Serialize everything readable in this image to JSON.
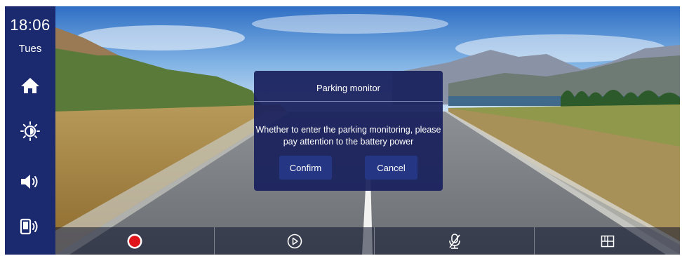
{
  "status": {
    "time": "18:06",
    "day": "Tues"
  },
  "sidebar": {
    "icons": [
      "home-icon",
      "brightness-icon",
      "volume-icon",
      "device-sound-icon"
    ]
  },
  "dialog": {
    "title": "Parking monitor",
    "message_line1": "Whether to enter the parking monitoring, please",
    "message_line2": "pay attention to the battery power",
    "confirm_label": "Confirm",
    "cancel_label": "Cancel"
  },
  "bottombar": {
    "icons": [
      "record-icon",
      "play-icon",
      "mic-muted-icon",
      "grid-layout-icon"
    ],
    "record_color": "#e0141b"
  },
  "colors": {
    "sidebar": "#1b2a6e",
    "dialog": "#1b225e",
    "button": "#253685"
  }
}
